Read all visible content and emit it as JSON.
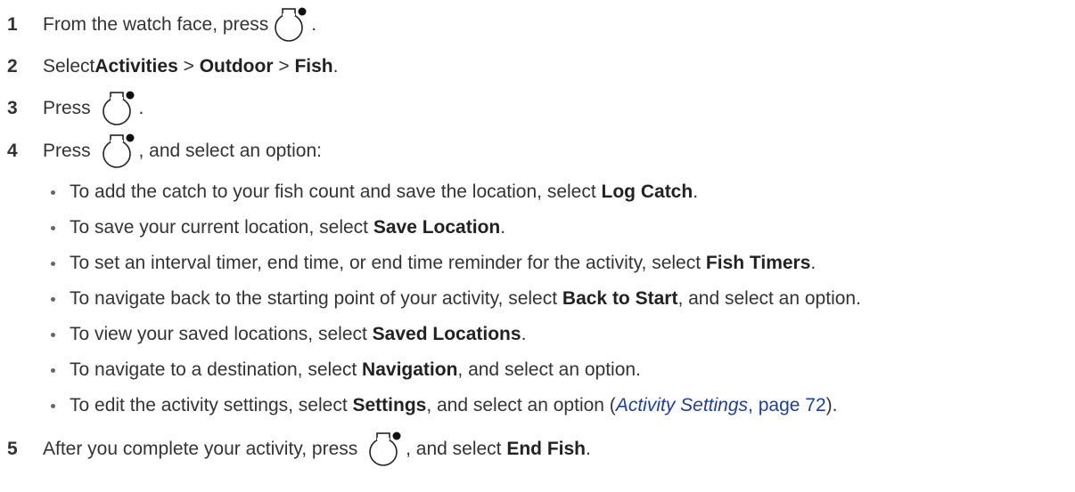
{
  "steps": [
    {
      "num": "1",
      "parts": [
        "From the watch face, press ",
        "."
      ]
    },
    {
      "num": "2",
      "pre": "Select ",
      "b1": "Activities",
      "sep1": " > ",
      "b2": "Outdoor",
      "sep2": " > ",
      "b3": "Fish",
      "post": "."
    },
    {
      "num": "3",
      "parts": [
        "Press ",
        "."
      ]
    },
    {
      "num": "4",
      "parts": [
        "Press ",
        ", and select an option:"
      ]
    },
    {
      "num": "5",
      "pre": "After you complete your activity, press ",
      "mid": ", and select ",
      "b1": "End Fish",
      "post": "."
    }
  ],
  "bullets": [
    {
      "pre": "To add the catch to your fish count and save the location, select ",
      "bold": "Log Catch",
      "post": "."
    },
    {
      "pre": "To save your current location, select ",
      "bold": "Save Location",
      "post": "."
    },
    {
      "pre": "To set an interval timer, end time, or end time reminder for the activity, select ",
      "bold": "Fish Timers",
      "post": "."
    },
    {
      "pre": "To navigate back to the starting point of your activity, select ",
      "bold": "Back to Start",
      "post": ", and select an option."
    },
    {
      "pre": "To view your saved locations, select ",
      "bold": "Saved Locations",
      "post": "."
    },
    {
      "pre": "To navigate to a destination, select ",
      "bold": "Navigation",
      "post": ", and select an option."
    },
    {
      "pre": "To edit the activity settings, select ",
      "bold": "Settings",
      "post": ", and select an option (",
      "link_italic": "Activity Settings",
      "link_page": ", page 72",
      "end": ")."
    }
  ],
  "icons": {
    "button": "watch-start-button-icon"
  }
}
